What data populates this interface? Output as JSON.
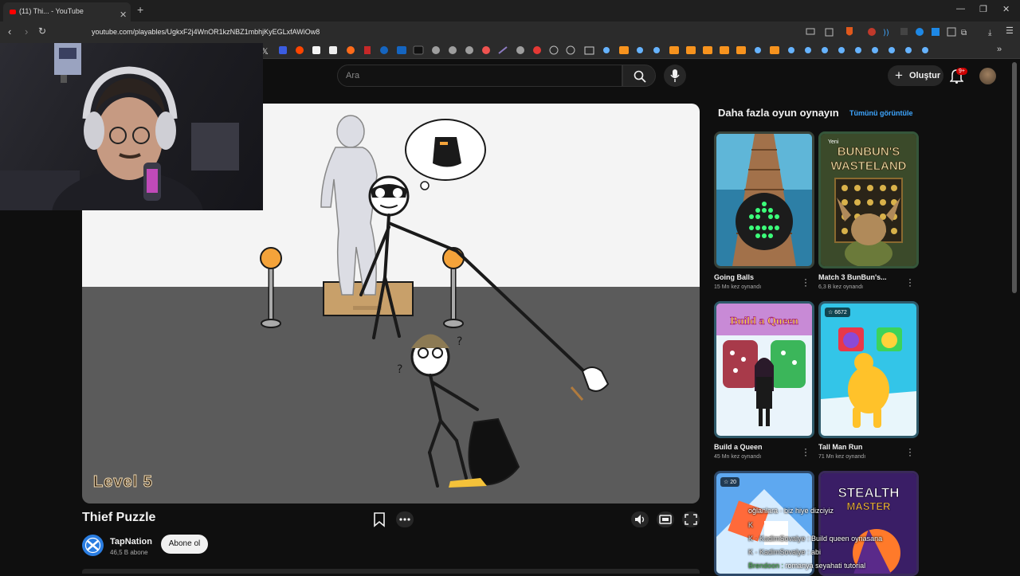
{
  "browser": {
    "tab_title": "(11) Thi... - YouTube",
    "url": "youtube.com/playables/UgkxF2j4WnOR1kzNBZ1mbhjKyEGLxfAWiOw8"
  },
  "header": {
    "search_placeholder": "Ara",
    "create_label": "Oluştur",
    "notification_count": "9+"
  },
  "game": {
    "level_label": "Level 5",
    "title": "Thief Puzzle"
  },
  "channel": {
    "name": "TapNation",
    "subscribers": "46,5 B abone",
    "subscribe_label": "Abone ol"
  },
  "sidebar": {
    "title": "Daha fazla oyun oynayın",
    "see_all": "Tümünü görüntüle",
    "cards": [
      {
        "name": "Going Balls",
        "plays": "15 Mn kez oynandı"
      },
      {
        "name": "Match 3 BunBun's...",
        "plays": "6,3 B kez oynandı",
        "badge": "Yeni",
        "art_title_1": "BUNBUN'S",
        "art_title_2": "WASTELAND"
      },
      {
        "name": "Build a Queen",
        "plays": "45 Mn kez oynandı",
        "art_title": "Build a Queen"
      },
      {
        "name": "Tall Man Run",
        "plays": "71 Mn kez oynandı",
        "badge": "☆ 6672"
      },
      {
        "badge": "☆ 20"
      },
      {
        "art_title_1": "STEALTH",
        "art_title_2": "MASTER"
      }
    ]
  },
  "chat": [
    {
      "user": "",
      "text": "oğlanlara · biz hiye dizciyiz"
    },
    {
      "user": "K",
      "text": ""
    },
    {
      "user": "K · KadimSovalye :",
      "text": "Build queen oynasana"
    },
    {
      "user": "K · KadimSovalye :",
      "text": "abi"
    },
    {
      "user": "Brendoon :",
      "text": "romanya seyahati tutorial"
    }
  ],
  "colors": {
    "accent_blue": "#3ea6ff",
    "notification_red": "#cc0000",
    "game_sky": "#f4f4f4",
    "game_floor": "#5b5b5b"
  }
}
